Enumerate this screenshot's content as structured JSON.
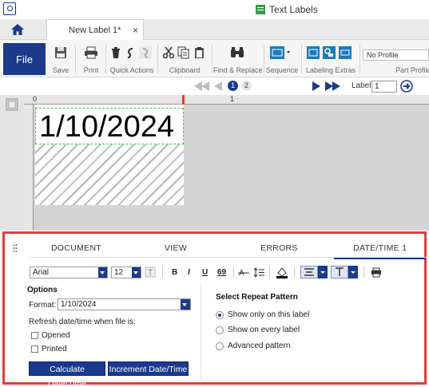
{
  "window": {
    "title": "Text Labels",
    "app_icon": "app-icon",
    "title_icon": "text-labels-icon"
  },
  "tabs": {
    "home_icon": "home-icon",
    "document_tab": "New Label 1*",
    "close_glyph": "×"
  },
  "ribbon": {
    "file_label": "File",
    "save_label": "Save",
    "print_label": "Print",
    "quick_actions_label": "Quick Actions",
    "clipboard_label": "Clipboard",
    "find_replace_label": "Find & Replace",
    "sequence_label": "Sequence",
    "labeling_extras_label": "Labeling Extras",
    "profile_value": "No Profile",
    "part_profile_label": "Part Profile"
  },
  "navigation": {
    "pages": [
      "1",
      "2"
    ],
    "current_page": "1",
    "label_prompt": "Label:",
    "label_value": "1"
  },
  "canvas": {
    "ruler_marks": [
      "0",
      "1"
    ],
    "date_text": "1/10/2024"
  },
  "panel": {
    "tabs": [
      "DOCUMENT",
      "VIEW",
      "ERRORS",
      "DATE/TIME 1"
    ],
    "active_tab": "DATE/TIME 1",
    "font_name": "Arial",
    "font_size": "12",
    "format_buttons": [
      "B",
      "I",
      "U",
      "69"
    ],
    "options_title": "Options",
    "format_label": "Format:",
    "format_value": "1/10/2024",
    "refresh_label": "Refresh date/time when file is:",
    "checkbox_opened": "Opened",
    "checkbox_printed": "Printed",
    "btn_calculate": "Calculate Date/Time",
    "btn_increment": "Increment Date/Time",
    "repeat_title": "Select Repeat Pattern",
    "radio_options": [
      "Show only on this label",
      "Show on every label",
      "Advanced pattern"
    ],
    "selected_radio": "Show only on this label"
  },
  "colors": {
    "accent": "#1b3a8c",
    "highlight": "#e33b3b",
    "selection": "#2ecc40"
  }
}
